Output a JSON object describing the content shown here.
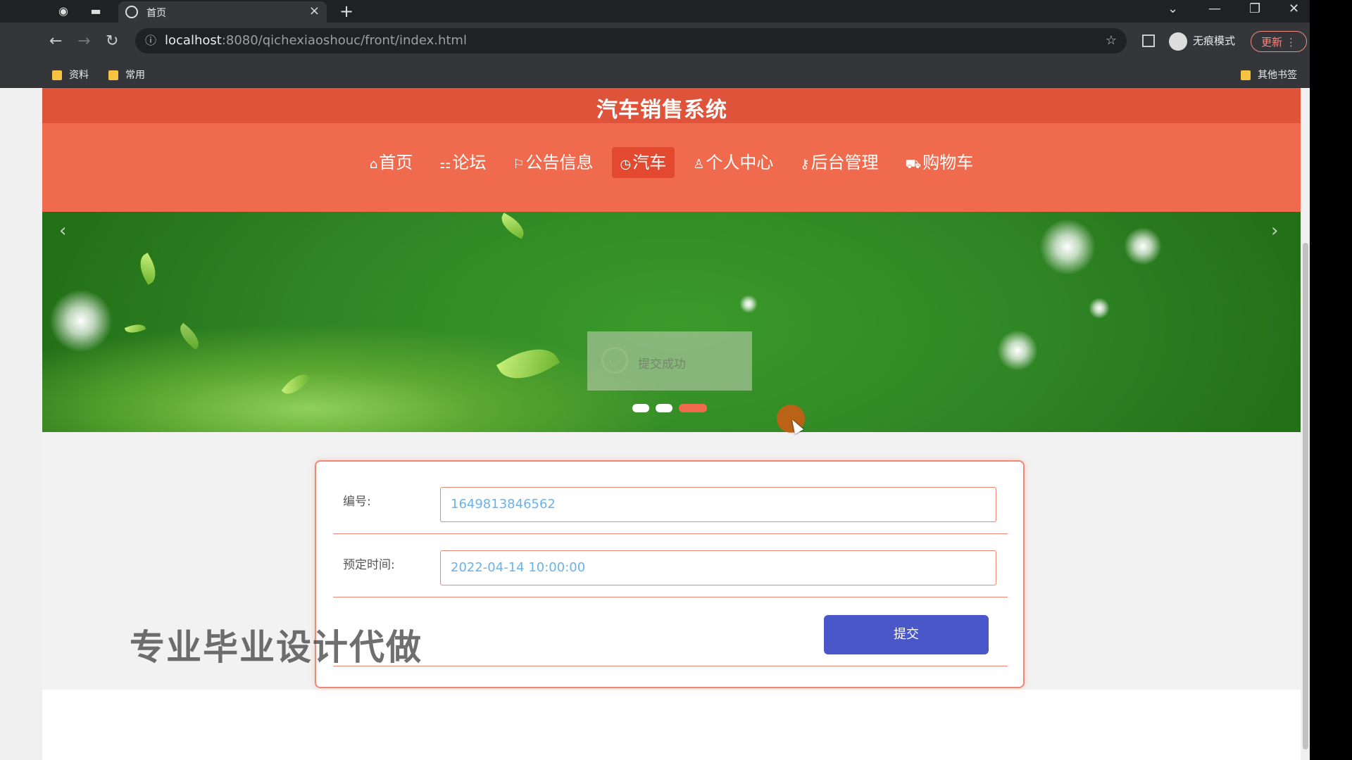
{
  "browser": {
    "tab_title": "首页",
    "url_host": "localhost",
    "url_path": ":8080/qichexiaoshouc/front/index.html",
    "incognito_label": "无痕模式",
    "update_label": "更新",
    "bookmarks": [
      "资料",
      "常用"
    ],
    "other_bookmarks": "其他书签"
  },
  "site": {
    "title": "汽车销售系统",
    "menu": [
      {
        "label": "首页",
        "icon": "⌂"
      },
      {
        "label": "论坛",
        "icon": "⚏"
      },
      {
        "label": "公告信息",
        "icon": "⚐"
      },
      {
        "label": "汽车",
        "icon": "◷"
      },
      {
        "label": "个人中心",
        "icon": "♙"
      },
      {
        "label": "后台管理",
        "icon": "⚷"
      },
      {
        "label": "购物车",
        "icon": "⛟"
      }
    ],
    "active_menu": "汽车"
  },
  "banner": {
    "toast_message": "提交成功",
    "slide_count": 3,
    "active_slide": 3
  },
  "form": {
    "number_label": "编号:",
    "number_value": "1649813846562",
    "time_label": "预定时间:",
    "time_value": "2022-04-14 10:00:00",
    "submit_label": "提交"
  },
  "watermark": "专业毕业设计代做",
  "colors": {
    "primary": "#f06a4e",
    "submit": "#4957c8"
  }
}
